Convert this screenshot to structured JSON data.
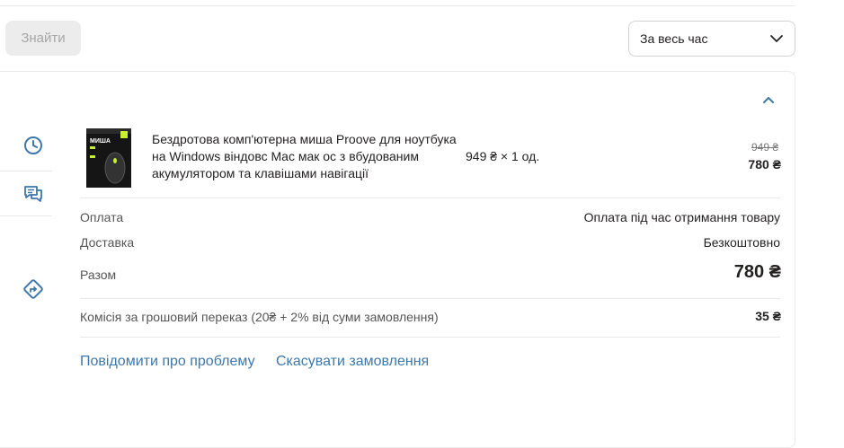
{
  "toolbar": {
    "find_label": "Знайти",
    "period_value": "За весь час"
  },
  "order": {
    "product": {
      "title": "Бездротова комп'ютерна миша Proove для ноутбука на Windows віндовс Mac мак ос з вбудованим акумулятором та клавішами навігації",
      "qty_text": "949 ₴ × 1 од.",
      "price_old": "949 ₴",
      "price_new": "780 ₴",
      "thumb_text": "МИША"
    },
    "payment": {
      "label": "Оплата",
      "value": "Оплата під час отримання товару"
    },
    "delivery": {
      "label": "Доставка",
      "value": "Безкоштовно"
    },
    "total": {
      "label": "Разом",
      "value": "780 ₴"
    },
    "commission": {
      "label": "Комісія за грошовий переказ (20₴ + 2% від суми замовлення)",
      "value": "35 ₴"
    },
    "links": {
      "report": "Повідомити про проблему",
      "cancel": "Скасувати замовлення"
    }
  },
  "colors": {
    "accent": "#3e77aa",
    "text": "#221f1f",
    "muted": "#797878",
    "border": "#e9e9e9"
  },
  "icons": [
    "chevron-down-icon",
    "chevron-up-icon",
    "clock-icon",
    "chat-icon",
    "route-icon"
  ]
}
